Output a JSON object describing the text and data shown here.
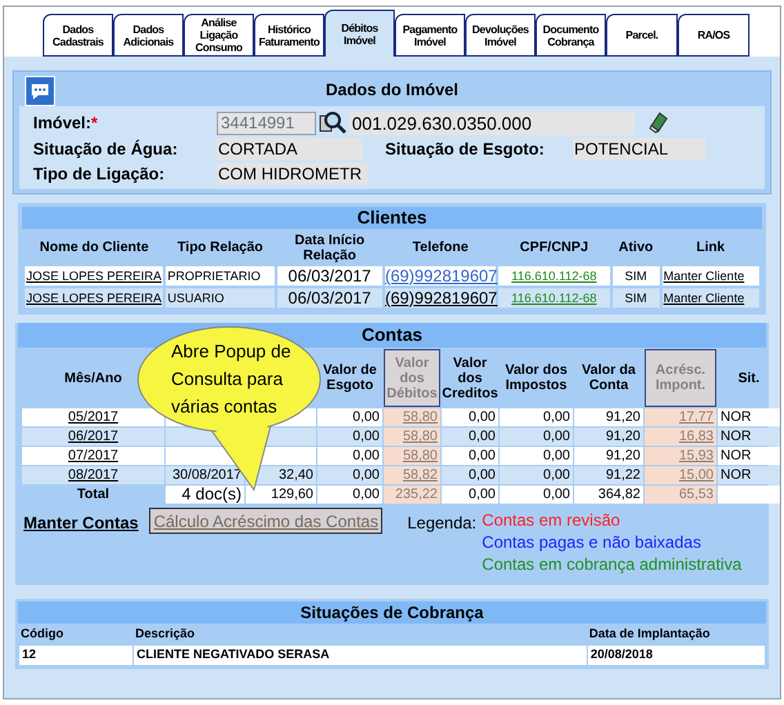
{
  "tabs": [
    {
      "label": "Dados Cadastrais",
      "selected": false
    },
    {
      "label": "Dados Adicionais",
      "selected": false
    },
    {
      "label": "Análise Ligação Consumo",
      "selected": false
    },
    {
      "label": "Histórico Faturamento",
      "selected": false
    },
    {
      "label": "Débitos Imóvel",
      "selected": true
    },
    {
      "label": "Pagamento Imóvel",
      "selected": false
    },
    {
      "label": "Devoluções Imóvel",
      "selected": false
    },
    {
      "label": "Documento Cobrança",
      "selected": false
    },
    {
      "label": "Parcel.",
      "selected": false
    },
    {
      "label": "RA/OS",
      "selected": false
    }
  ],
  "dados_imovel": {
    "title": "Dados do Imóvel",
    "imovel_label": "Imóvel:",
    "required_mark": "*",
    "matricula": "34414991",
    "inscricao": "001.029.630.0350.000",
    "situacao_agua_label": "Situação de Água:",
    "situacao_agua": "CORTADA",
    "situacao_esgoto_label": "Situação de Esgoto:",
    "situacao_esgoto": "POTENCIAL",
    "tipo_ligacao_label": "Tipo de Ligação:",
    "tipo_ligacao": "COM HIDROMETR"
  },
  "clientes": {
    "title": "Clientes",
    "columns": [
      "Nome do Cliente",
      "Tipo Relação",
      "Data Início Relação",
      "Telefone",
      "CPF/CNPJ",
      "Ativo",
      "Link"
    ],
    "rows": [
      {
        "nome": "JOSE LOPES PEREIRA",
        "tipo": "PROPRIETARIO",
        "data": "06/03/2017",
        "telefone": "(69)992819607",
        "telefone_focused": true,
        "cpf": "116.610.112-68",
        "ativo": "SIM",
        "link": "Manter Cliente"
      },
      {
        "nome": "JOSE LOPES PEREIRA",
        "tipo": "USUARIO",
        "data": "06/03/2017",
        "telefone": "(69)992819607",
        "telefone_focused": false,
        "cpf": "116.610.112-68",
        "ativo": "SIM",
        "link": "Manter Cliente"
      }
    ]
  },
  "contas": {
    "title": "Contas",
    "columns": {
      "mes": "Mês/Ano",
      "esgoto": "Valor de Esgoto",
      "debitos": "Valor dos Débitos",
      "creditos": "Valor dos Creditos",
      "impostos": "Valor dos Impostos",
      "conta": "Valor da Conta",
      "acresc": "Acrésc. Impont.",
      "sit": "Sit."
    },
    "rows": [
      {
        "mes": "05/2017",
        "esgoto": "0,00",
        "debitos": "58,80",
        "creditos": "0,00",
        "impostos": "0,00",
        "conta": "91,20",
        "acresc": "17,77",
        "sit": "NOR"
      },
      {
        "mes": "06/2017",
        "esgoto": "0,00",
        "debitos": "58,80",
        "creditos": "0,00",
        "impostos": "0,00",
        "conta": "91,20",
        "acresc": "16,83",
        "sit": "NOR"
      },
      {
        "mes": "07/2017",
        "esgoto": "0,00",
        "debitos": "58,80",
        "creditos": "0,00",
        "impostos": "0,00",
        "conta": "91,20",
        "acresc": "15,93",
        "sit": "NOR"
      },
      {
        "mes": "08/2017",
        "vencimento": "30/08/2017",
        "agua": "32,40",
        "esgoto": "0,00",
        "debitos": "58,82",
        "creditos": "0,00",
        "impostos": "0,00",
        "conta": "91,22",
        "acresc": "15,00",
        "sit": "NOR"
      }
    ],
    "total": {
      "mes": "Total",
      "vencimento": "4  doc(s)",
      "agua": "129,60",
      "esgoto": "0,00",
      "debitos": "235,22",
      "creditos": "0,00",
      "impostos": "0,00",
      "conta": "364,82",
      "acresc": "65,53"
    },
    "manter_link": "Manter Contas",
    "calculo_button": "Cálculo Acréscimo das Contas",
    "legend_label": "Legenda:",
    "legend": [
      {
        "label": "Contas em revisão",
        "color": "#ff2020"
      },
      {
        "label": "Contas pagas e não baixadas",
        "color": "#2020ff"
      },
      {
        "label": "Contas em cobrança administrativa",
        "color": "#209020"
      }
    ],
    "callout": "Abre Popup de Consulta para várias contas"
  },
  "cobranca": {
    "title": "Situações de Cobrança",
    "columns": [
      "Código",
      "Descrição",
      "Data de Implantação"
    ],
    "rows": [
      [
        "12",
        "CLIENTE NEGATIVADO SERASA",
        "20/08/2018"
      ]
    ]
  }
}
